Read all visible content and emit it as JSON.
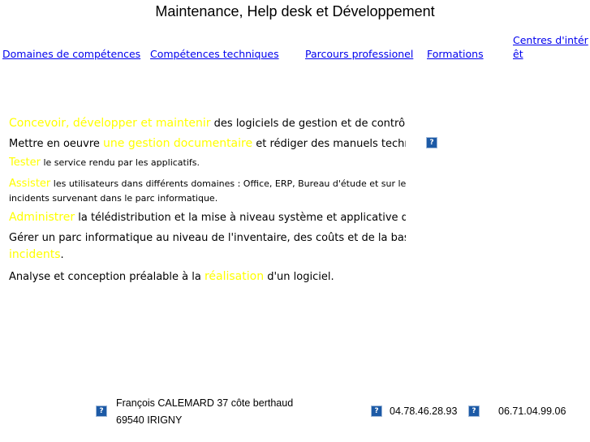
{
  "header": {
    "title": "Maintenance, Help desk et Développement"
  },
  "nav": {
    "items": [
      {
        "label": "Domaines de compétences"
      },
      {
        "label": "Compétences techniques"
      },
      {
        "label": "Parcours professionel"
      },
      {
        "label": "Formations"
      },
      {
        "label": "Centres d'intérêt"
      }
    ]
  },
  "content": {
    "line1": {
      "highlight": "Concevoir, développer et maintenir",
      "text": " des logiciels de gestion et de contrôle"
    },
    "line2": {
      "before": "Mettre en oeuvre ",
      "highlight": "une gestion documentaire",
      "after": " et rédiger des manuels techniques"
    },
    "line3": {
      "highlight": "Tester",
      "text": " le service rendu par les applicatifs."
    },
    "line4": {
      "highlight": "Assister",
      "text": " les utilisateurs dans différents domaines : Office, ERP, Bureau d'étude et sur les",
      "text2": "incidents survenant dans le parc informatique."
    },
    "line5": {
      "highlight": "Administrer",
      "text": " la télédistribution et la mise à niveau système et applicative des postes"
    },
    "line6": {
      "text": "Gérer un parc informatique au niveau de l'inventaire, des coûts et de la base des",
      "highlight": "incidents",
      "after": "."
    },
    "line7": {
      "before": "Analyse et conception préalable à la ",
      "highlight": "réalisation",
      "after": " d'un logiciel."
    }
  },
  "footer": {
    "address_line1": "François CALEMARD 37 côte berthaud",
    "address_line2": "69540 IRIGNY",
    "phone1": "04.78.46.28.93",
    "phone2": "06.71.04.99.06"
  },
  "icons": {
    "broken_image": "?"
  },
  "colors": {
    "highlight": "#ffff00",
    "link": "#0000ee"
  }
}
